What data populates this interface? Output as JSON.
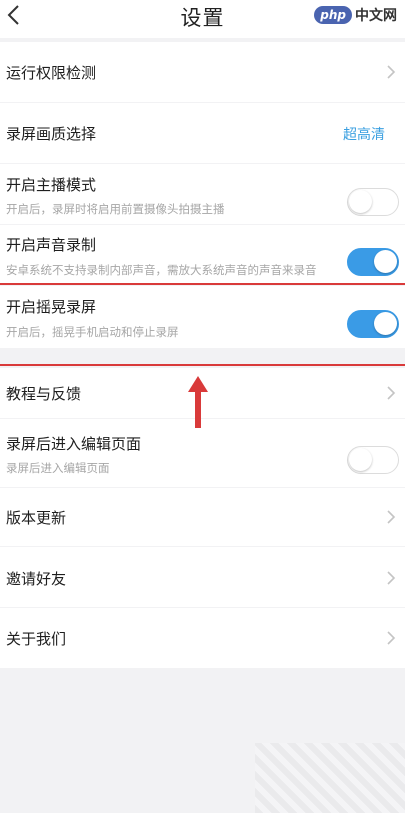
{
  "header": {
    "title": "设置",
    "logo_badge": "php",
    "logo_text": "中文网"
  },
  "rows": [
    {
      "label": "运行权限检测",
      "sub": "",
      "value": "",
      "control": "chevron"
    },
    {
      "label": "录屏画质选择",
      "sub": "",
      "value": "超高清",
      "control": "value"
    },
    {
      "label": "开启主播模式",
      "sub": "开启后，录屏时将启用前置摄像头拍摄主播",
      "value": "",
      "control": "toggle",
      "on": false
    },
    {
      "label": "开启声音录制",
      "sub": "安卓系统不支持录制内部声音，需放大系统声音的声音来录音",
      "value": "",
      "control": "toggle",
      "on": true
    },
    {
      "label": "开启摇晃录屏",
      "sub": "开启后，摇晃手机启动和停止录屏",
      "value": "",
      "control": "toggle",
      "on": true
    },
    {
      "label": "教程与反馈",
      "sub": "",
      "value": "",
      "control": "chevron"
    },
    {
      "label": "录屏后进入编辑页面",
      "sub": "录屏后进入编辑页面",
      "value": "",
      "control": "toggle",
      "on": false
    },
    {
      "label": "版本更新",
      "sub": "",
      "value": "",
      "control": "chevron"
    },
    {
      "label": "邀请好友",
      "sub": "",
      "value": "",
      "control": "chevron"
    },
    {
      "label": "关于我们",
      "sub": "",
      "value": "",
      "control": "chevron"
    }
  ],
  "colors": {
    "accent": "#3a9be6",
    "annotation_red": "#d93a3a",
    "value_blue": "#3a9fe0"
  },
  "icons": {
    "back": "chevron-left-icon",
    "row_chevron": "chevron-right-icon"
  }
}
